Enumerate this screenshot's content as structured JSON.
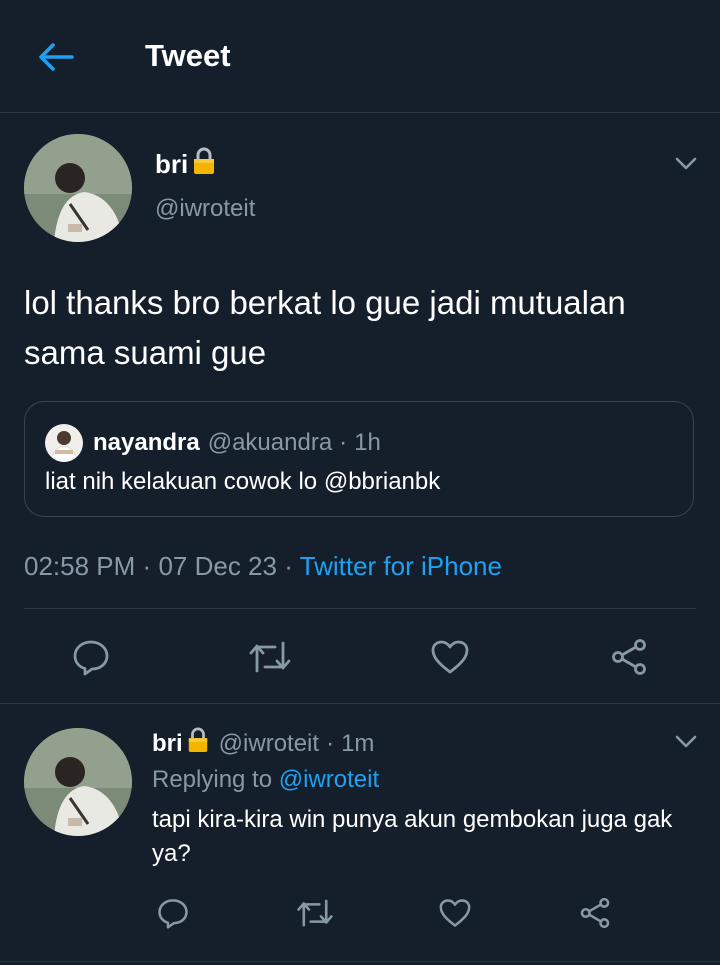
{
  "header": {
    "title": "Tweet",
    "back_icon": "arrow-left-icon"
  },
  "colors": {
    "background": "#151f2b",
    "accent": "#1da1f2",
    "muted": "#8899a6",
    "divider": "#2b3744"
  },
  "main_tweet": {
    "display_name": "bri",
    "handle": "@iwroteit",
    "text": "lol thanks bro berkat lo gue jadi mutualan sama suami gue",
    "quoted": {
      "display_name": "nayandra",
      "handle": "@akuandra",
      "separator": "·",
      "time": "1h",
      "text": "liat nih kelakuan cowok lo @bbrianbk"
    },
    "time": "02:58 PM",
    "sep1": "·",
    "date": "07 Dec 23",
    "sep2": "·",
    "source": "Twitter for iPhone",
    "actions": [
      "reply-icon",
      "retweet-icon",
      "like-icon",
      "share-icon"
    ]
  },
  "reply_tweet": {
    "display_name": "bri",
    "handle": "@iwroteit",
    "separator": "·",
    "time": "1m",
    "replying_label": "Replying to",
    "replying_handle": "@iwroteit",
    "text": "tapi kira-kira win punya akun gembokan juga gak ya?"
  }
}
